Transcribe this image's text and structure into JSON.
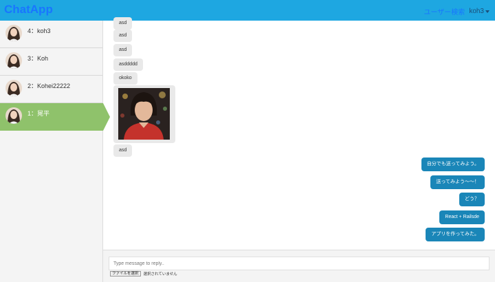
{
  "navbar": {
    "brand": "ChatApp",
    "search_link": "ユーザー検索",
    "current_user": "koh3"
  },
  "sidebar": {
    "users": [
      {
        "label": "4：koh3",
        "active": false
      },
      {
        "label": "3：Koh",
        "active": false
      },
      {
        "label": "2：Kohei22222",
        "active": false
      },
      {
        "label": "1：晃平",
        "active": true
      }
    ]
  },
  "messages": {
    "incoming": [
      "asd",
      "asd",
      "asd",
      "asddddd",
      "okoko",
      "asd"
    ],
    "outgoing": [
      "自分でも送ってみよう。",
      "送ってみよう〜〜！",
      "どう？",
      "React + Railsde",
      "アプリを作ってみた。"
    ]
  },
  "reply": {
    "placeholder": "Type message to reply..",
    "file_button": "ファイルを選択",
    "file_status": "選択されていません"
  },
  "colors": {
    "navbar": "#1ea7e1",
    "brand": "#1976ff",
    "active_user": "#8fc26b",
    "outgoing_bubble": "#1a86b8",
    "incoming_bubble": "#e9e9e9"
  }
}
